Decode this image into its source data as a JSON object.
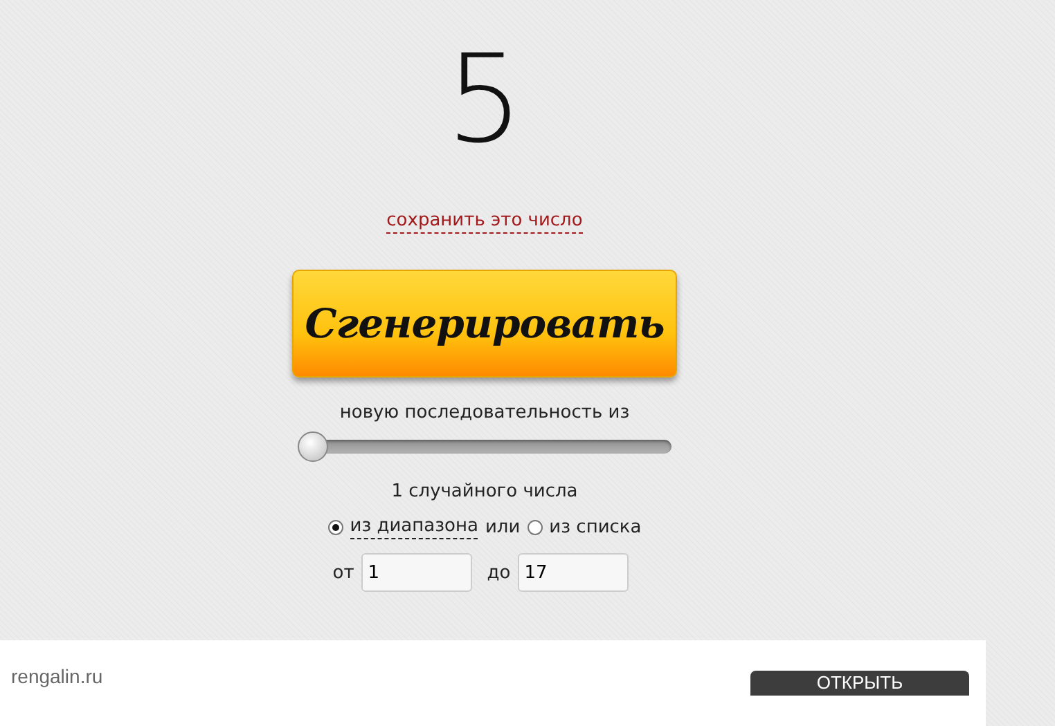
{
  "result": "5",
  "save_link": "сохранить это число",
  "generate_button": "Сгенерировать",
  "sequence_label": "новую последовательность из",
  "count_slider": {
    "level": 0
  },
  "count_label": "1 случайного числа",
  "source_options": [
    {
      "label": "из диапазона",
      "selected": true,
      "dashed": true
    },
    {
      "label": "или",
      "kind": "text"
    },
    {
      "label": "из списка",
      "selected": false,
      "dashed": false
    }
  ],
  "range": [
    {
      "label": "от",
      "value": "1"
    },
    {
      "label": "до",
      "value": "17"
    }
  ],
  "ad": {
    "site": "rengalin.ru",
    "button": "ОТКРЫТЬ"
  }
}
